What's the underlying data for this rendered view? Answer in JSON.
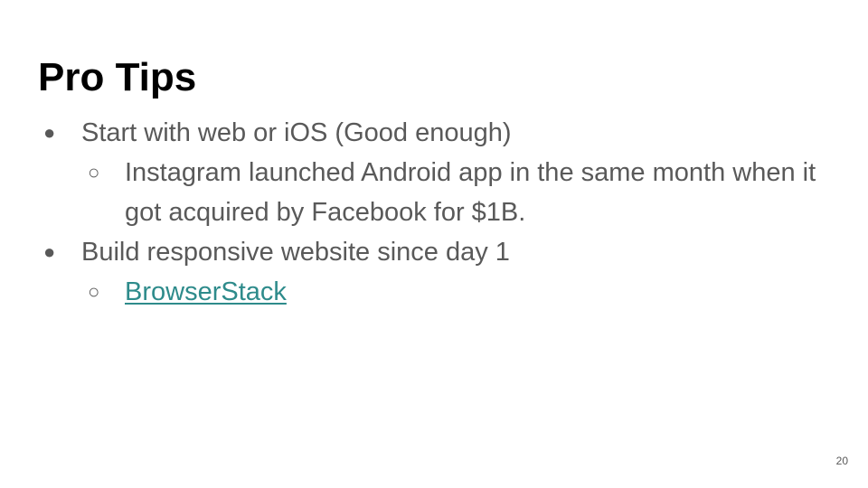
{
  "slide": {
    "title": "Pro Tips",
    "page_number": "20",
    "link_color": "#2e8b8b",
    "text_color": "#595959",
    "bullets": [
      {
        "marker": "●",
        "text": "Start with web or iOS (Good enough)",
        "children": [
          {
            "marker": "○",
            "text": "Instagram launched Android app in the same month when it got acquired by Facebook for $1B."
          }
        ]
      },
      {
        "marker": "●",
        "text": "Build responsive website since day 1",
        "children": [
          {
            "marker": "○",
            "text": "BrowserStack",
            "is_link": true
          }
        ]
      }
    ]
  }
}
